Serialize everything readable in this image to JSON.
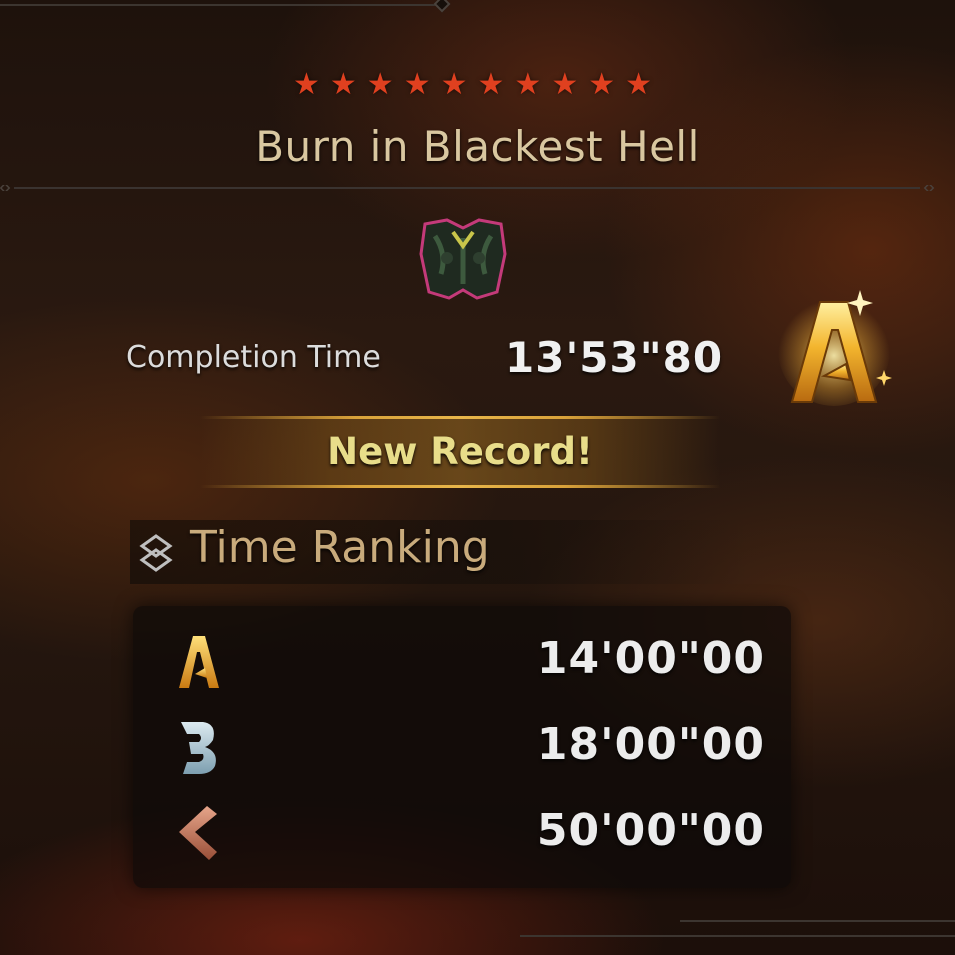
{
  "quest": {
    "stars": [
      "★",
      "★",
      "★",
      "★",
      "★",
      "★",
      "★",
      "★",
      "★",
      "★"
    ],
    "star_color": "#e0401f",
    "title": "Burn in Blackest Hell",
    "monster_icon": "monster-icon"
  },
  "result": {
    "completion_label": "Completion Time",
    "completion_time": "13'53\"80",
    "achieved_rank": "A",
    "new_record_label": "New Record!"
  },
  "ranking": {
    "title": "Time Ranking",
    "icon": "time-ranking-icon",
    "rows": [
      {
        "rank": "A",
        "time": "14'00\"00",
        "color": "#e6a826"
      },
      {
        "rank": "B",
        "time": "18'00\"00",
        "color": "#a9c7d6"
      },
      {
        "rank": "C",
        "time": "50'00\"00",
        "color": "#c27a5c"
      }
    ]
  },
  "colors": {
    "title_text": "#d9c7a0",
    "record_text": "#e8dd8a",
    "gold": "#e6a826"
  }
}
